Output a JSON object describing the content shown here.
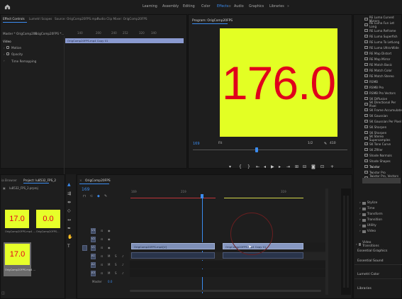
{
  "nav": {
    "items": [
      "Learning",
      "Assembly",
      "Editing",
      "Color",
      "Effects",
      "Audio",
      "Graphics",
      "Libraries"
    ],
    "active": "Effects"
  },
  "source_panel": {
    "tabs": [
      "Effect Controls",
      "Lumetri Scopes",
      "Source: OrigComp20FPS.mp4",
      "Audio Clip Mixer: OrigComp20FPS"
    ],
    "master_label": "Master * OrigComp20F...",
    "seq_label": "OrigComp20FPS *...",
    "video_label": "Video",
    "clip_label": "OrigComp20FPS.mp4 Copy 01",
    "params": [
      "Motion",
      "Opacity",
      "Time Remapping"
    ],
    "ruler": [
      "140",
      "200",
      "240",
      "252",
      "320",
      "340"
    ]
  },
  "program": {
    "title": "Program: OrigComp20FPS",
    "value": "176.0",
    "timecode": "169",
    "fit": "Fit",
    "quality": "1/2",
    "duration": "410"
  },
  "project": {
    "tabs": [
      "ia Browser",
      "Project: lu8532_FPS_2"
    ],
    "filename": "lu8532_FPS_2.prproj",
    "items": [
      {
        "value": "17.0",
        "label": "OrigComp20FPS.mp4 ...",
        "dur": "8:05"
      },
      {
        "value": "0.0",
        "label": "OrigComp20FPS...",
        "dur": "1702"
      },
      {
        "value": "17.0",
        "label": "OrigComp20FPS.mp4 ...",
        "dur": "8:06"
      }
    ]
  },
  "timeline": {
    "title": "OrigComp20FPS",
    "timecode": "169",
    "ruler": [
      "169",
      "219",
      "319"
    ],
    "clip_a": "OrigComp20FPS.mp4[V]",
    "clip_b": "OrigComp20FPS.mp4 Copy 01",
    "tracks": [
      "V3",
      "V2",
      "V1",
      "A1",
      "A2",
      "A3"
    ],
    "mix_label": "Master",
    "mix_value": "0.0"
  },
  "effects": {
    "items": [
      "RE Luma Curved Mirrors",
      "RE Luma Fun Let Long",
      "RE Luma Reframe",
      "RE Luma Superfish",
      "RE Luma To LetLong",
      "RE Luma Ultra-Wide",
      "RE Map Distort",
      "RE Map Mirror",
      "RE Match Basic",
      "RE Match Color",
      "RE Match Stereo",
      "RSMB",
      "RSMB Pro",
      "RSMB Pro Vectors",
      "SK Diffusion",
      "SK Directional Per Pixel",
      "SK Frame Accumulate",
      "SK Gaussian",
      "SK Gaussian Per Pixel",
      "SK Sharpen",
      "SK Sharpen",
      "SK Stereo Supersamples",
      "SK Tone Curve",
      "SK Zfiller",
      "Shade Normals",
      "Shade Shapes",
      "Twixtor",
      "Twixtor Pro",
      "Twixtor Pro, Vectors In"
    ],
    "selected": "Twixtor",
    "folders": [
      "Stylize",
      "Time",
      "Transform",
      "Transition",
      "Utility",
      "Video"
    ],
    "video_transitions": "Video Transitions",
    "panels": [
      "Essential Graphics",
      "Essential Sound",
      "Lumetri Color",
      "Libraries"
    ]
  },
  "colors": {
    "accent": "#3b8cf0",
    "frame": "#e3ff24",
    "digits": "#e0001b",
    "clip": "#7e8fb7"
  }
}
